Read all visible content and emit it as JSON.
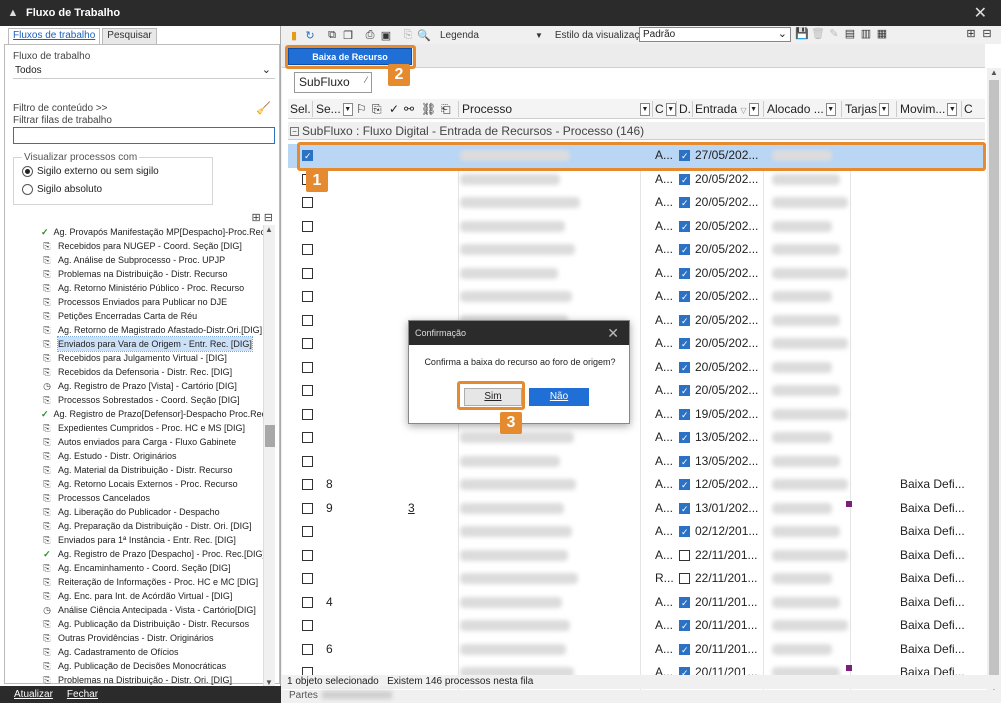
{
  "window": {
    "title": "Fluxo de Trabalho"
  },
  "left": {
    "tabs": [
      "Fluxos de trabalho",
      "Pesquisar"
    ],
    "workflow_label": "Fluxo de trabalho",
    "workflow_value": "Todos",
    "content_filter": "Filtro de conteúdo >>",
    "queue_filter_label": "Filtrar filas de trabalho",
    "visualize_label": "Visualizar processos com",
    "radio_external": "Sigilo externo ou sem sigilo",
    "radio_absolute": "Sigilo absoluto",
    "tree": [
      {
        "icon": "check",
        "label": "Ag. Provapós Manifestação MP[Despacho]-Proc.Rec."
      },
      {
        "icon": "doc",
        "label": "Recebidos para NUGEP - Coord. Seção [DIG]"
      },
      {
        "icon": "doc",
        "label": "Ag. Análise de Subprocesso - Proc. UPJP"
      },
      {
        "icon": "doc",
        "label": "Problemas na Distribuição - Distr. Recurso"
      },
      {
        "icon": "doc",
        "label": "Ag. Retorno Ministério Público - Proc. Recurso"
      },
      {
        "icon": "doc",
        "label": "Processos Enviados para Publicar no DJE"
      },
      {
        "icon": "doc",
        "label": "Petições Encerradas Carta de Réu"
      },
      {
        "icon": "doc",
        "label": "Ag. Retorno de Magistrado Afastado-Distr.Ori.[DIG]"
      },
      {
        "icon": "doc",
        "label": "Enviados para Vara de Origem - Entr. Rec. [DIG]",
        "selected": true
      },
      {
        "icon": "doc",
        "label": "Recebidos para Julgamento Virtual - [DIG]"
      },
      {
        "icon": "doc",
        "label": "Recebidos da Defensoria - Distr. Rec. [DIG]"
      },
      {
        "icon": "clock",
        "label": "Ag. Registro de Prazo [Vista] - Cartório [DIG]"
      },
      {
        "icon": "doc",
        "label": "Processos Sobrestados - Coord. Seção [DIG]"
      },
      {
        "icon": "check",
        "label": "Ag. Registro de Prazo[Defensor]-Despacho Proc.Rec"
      },
      {
        "icon": "doc",
        "label": "Expedientes Cumpridos - Proc. HC e MS [DIG]"
      },
      {
        "icon": "doc",
        "label": "Autos enviados para Carga - Fluxo Gabinete"
      },
      {
        "icon": "doc",
        "label": "Ag. Estudo - Distr. Originários"
      },
      {
        "icon": "doc",
        "label": "Ag. Material da Distribuição - Distr. Recurso"
      },
      {
        "icon": "doc",
        "label": "Ag. Retorno Locais Externos - Proc. Recurso"
      },
      {
        "icon": "doc",
        "label": "Processos Cancelados"
      },
      {
        "icon": "doc",
        "label": "Ag. Liberação do Publicador - Despacho"
      },
      {
        "icon": "doc",
        "label": "Ag. Preparação da Distribuição - Distr. Ori. [DIG]"
      },
      {
        "icon": "doc",
        "label": "Enviados para 1ª Instância - Entr. Rec. [DIG]"
      },
      {
        "icon": "check",
        "label": "Ag. Registro de Prazo [Despacho] - Proc. Rec.[DIG]"
      },
      {
        "icon": "doc",
        "label": "Ag. Encaminhamento - Coord. Seção [DIG]"
      },
      {
        "icon": "doc",
        "label": "Reiteração de Informações - Proc. HC e MC [DIG]"
      },
      {
        "icon": "doc",
        "label": "Ag. Enc. para Int. de Acórdão Virtual - [DIG]"
      },
      {
        "icon": "clock",
        "label": "Análise Ciência Antecipada - Vista - Cartório[DIG]"
      },
      {
        "icon": "doc",
        "label": "Ag. Publicação da Distribuição - Distr. Recursos"
      },
      {
        "icon": "doc",
        "label": "Outras Providências - Distr. Originários"
      },
      {
        "icon": "doc",
        "label": "Ag. Cadastramento de Ofícios"
      },
      {
        "icon": "doc",
        "label": "Ag. Publicação de Decisões Monocráticas"
      },
      {
        "icon": "doc",
        "label": "Problemas na Distribuição - Distr. Ori. [DIG]"
      }
    ],
    "footer_update": "Atualizar",
    "footer_close": "Fechar"
  },
  "toolbar": {
    "legend": "Legenda",
    "view_style_label": "Estilo da visualização",
    "view_style_value": "Padrão"
  },
  "action": {
    "baixa_label": "Baixa de Recurso Eletrônico",
    "group_by": "SubFluxo"
  },
  "grid": {
    "headers": [
      "Sel.",
      "Se...",
      "Processo",
      "C",
      "D.",
      "Entrada",
      "Alocado ...",
      "Tarjas",
      "Movim...",
      "C"
    ],
    "group_label": "SubFluxo : Fluxo Digital - Entrada de Recursos - Processo  (146)",
    "rows": [
      {
        "sel": true,
        "seq": "",
        "comments": "",
        "c": "A...",
        "d": true,
        "date": "27/05/202...",
        "tarja": false,
        "mov": "",
        "selected": true
      },
      {
        "sel": false,
        "seq": "",
        "comments": "",
        "c": "A...",
        "d": true,
        "date": "20/05/202...",
        "tarja": false,
        "mov": ""
      },
      {
        "sel": false,
        "seq": "",
        "comments": "",
        "c": "A...",
        "d": true,
        "date": "20/05/202...",
        "tarja": false,
        "mov": ""
      },
      {
        "sel": false,
        "seq": "",
        "comments": "",
        "c": "A...",
        "d": true,
        "date": "20/05/202...",
        "tarja": false,
        "mov": ""
      },
      {
        "sel": false,
        "seq": "",
        "comments": "",
        "c": "A...",
        "d": true,
        "date": "20/05/202...",
        "tarja": false,
        "mov": ""
      },
      {
        "sel": false,
        "seq": "",
        "comments": "",
        "c": "A...",
        "d": true,
        "date": "20/05/202...",
        "tarja": false,
        "mov": ""
      },
      {
        "sel": false,
        "seq": "",
        "comments": "",
        "c": "A...",
        "d": true,
        "date": "20/05/202...",
        "tarja": false,
        "mov": ""
      },
      {
        "sel": false,
        "seq": "",
        "comments": "",
        "c": "A...",
        "d": true,
        "date": "20/05/202...",
        "tarja": false,
        "mov": ""
      },
      {
        "sel": false,
        "seq": "",
        "comments": "",
        "c": "A...",
        "d": true,
        "date": "20/05/202...",
        "tarja": false,
        "mov": ""
      },
      {
        "sel": false,
        "seq": "",
        "comments": "",
        "c": "A...",
        "d": true,
        "date": "20/05/202...",
        "tarja": false,
        "mov": ""
      },
      {
        "sel": false,
        "seq": "",
        "comments": "",
        "c": "A...",
        "d": true,
        "date": "20/05/202...",
        "tarja": false,
        "mov": ""
      },
      {
        "sel": false,
        "seq": "",
        "comments": "",
        "c": "A...",
        "d": true,
        "date": "19/05/202...",
        "tarja": false,
        "mov": ""
      },
      {
        "sel": false,
        "seq": "",
        "comments": "",
        "c": "A...",
        "d": true,
        "date": "13/05/202...",
        "tarja": false,
        "mov": ""
      },
      {
        "sel": false,
        "seq": "",
        "comments": "",
        "c": "A...",
        "d": true,
        "date": "13/05/202...",
        "tarja": false,
        "mov": ""
      },
      {
        "sel": false,
        "seq": "8",
        "comments": "",
        "c": "A...",
        "d": true,
        "date": "12/05/202...",
        "tarja": false,
        "mov": "Baixa Defi..."
      },
      {
        "sel": false,
        "seq": "9",
        "comments": "3",
        "c": "A...",
        "d": true,
        "date": "13/01/202...",
        "tarja": true,
        "mov": "Baixa Defi..."
      },
      {
        "sel": false,
        "seq": "",
        "comments": "",
        "c": "A...",
        "d": true,
        "date": "02/12/201...",
        "tarja": false,
        "mov": "Baixa Defi..."
      },
      {
        "sel": false,
        "seq": "",
        "comments": "",
        "c": "A...",
        "d": false,
        "date": "22/11/201...",
        "tarja": false,
        "mov": "Baixa Defi..."
      },
      {
        "sel": false,
        "seq": "",
        "comments": "",
        "c": "R...",
        "d": false,
        "date": "22/11/201...",
        "tarja": false,
        "mov": "Baixa Defi..."
      },
      {
        "sel": false,
        "seq": "4",
        "comments": "",
        "c": "A...",
        "d": true,
        "date": "20/11/201...",
        "tarja": false,
        "mov": "Baixa Defi..."
      },
      {
        "sel": false,
        "seq": "",
        "comments": "",
        "c": "A...",
        "d": true,
        "date": "20/11/201...",
        "tarja": false,
        "mov": "Baixa Defi..."
      },
      {
        "sel": false,
        "seq": "6",
        "comments": "",
        "c": "A...",
        "d": true,
        "date": "20/11/201...",
        "tarja": false,
        "mov": "Baixa Defi..."
      },
      {
        "sel": false,
        "seq": "",
        "comments": "",
        "c": "A...",
        "d": true,
        "date": "20/11/201...",
        "tarja": true,
        "mov": "Baixa Defi..."
      }
    ]
  },
  "status": {
    "selection": "1 objeto selecionado",
    "count": "Existem 146 processos nesta fila",
    "parts": "Partes"
  },
  "dialog": {
    "title": "Confirmação",
    "message": "Confirma a baixa do recurso ao foro de origem?",
    "yes": "Sim",
    "no": "Não"
  },
  "callouts": [
    "1",
    "2",
    "3"
  ],
  "colors": {
    "accent": "#1f6fd6",
    "highlight": "#e58a2e",
    "titlebar": "#2b2b2b"
  }
}
